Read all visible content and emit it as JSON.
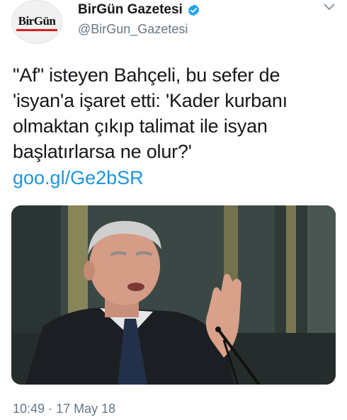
{
  "account": {
    "avatar_logo": "BirGün",
    "display_name": "BirGün Gazetesi",
    "handle": "@BirGun_Gazetesi",
    "verified": true,
    "verified_icon": "verified-badge-icon"
  },
  "tweet": {
    "text_lines": [
      "\"Af\" isteyen Bahçeli, bu sefer de",
      "'isyan'a işaret etti: 'Kader kurbanı",
      "olmaktan çıkıp talimat ile isyan",
      "başlatırlarsa ne olur?'"
    ],
    "link": "goo.gl/Ge2bSR",
    "time": "10:49",
    "separator": "·",
    "date": "17 May 18"
  },
  "icons": {
    "menu": "chevron-down-icon"
  },
  "colors": {
    "link": "#1b95e0",
    "verified": "#1da1f2",
    "secondary_text": "#657786",
    "primary_text": "#14171a",
    "brand_red": "#d7201d"
  }
}
